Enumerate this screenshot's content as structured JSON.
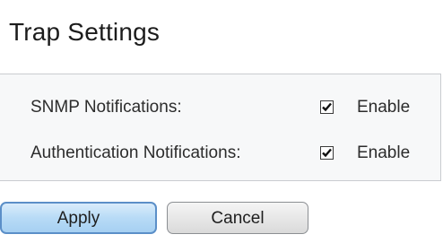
{
  "section": {
    "title": "Trap Settings"
  },
  "fields": [
    {
      "label": "SNMP Notifications:",
      "checked": true,
      "option_label": "Enable"
    },
    {
      "label": "Authentication Notifications:",
      "checked": true,
      "option_label": "Enable"
    }
  ],
  "actions": {
    "apply_label": "Apply",
    "cancel_label": "Cancel"
  },
  "icons": {
    "checkmark": "checkmark-icon"
  },
  "colors": {
    "primary_button_border": "#5b8fc8",
    "primary_button_fill": "#b8dbf6",
    "panel_background": "#f7f8f9"
  }
}
